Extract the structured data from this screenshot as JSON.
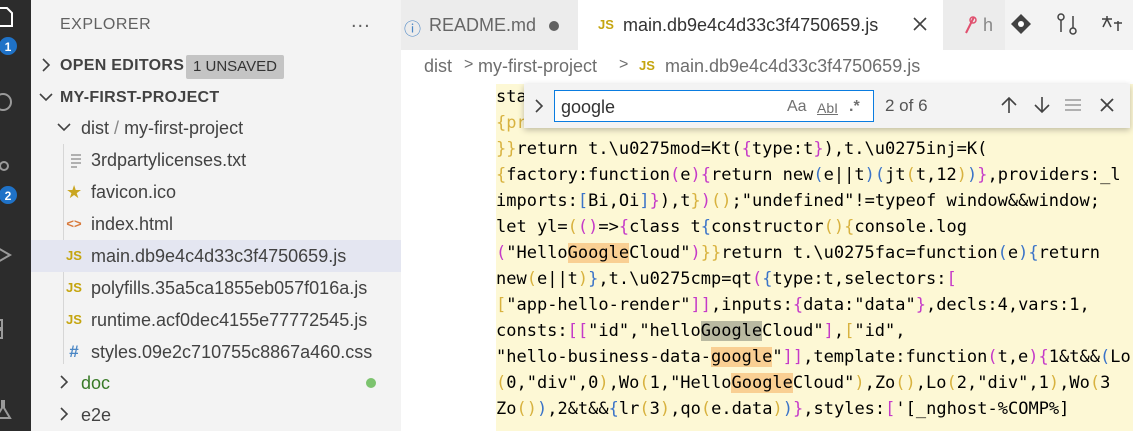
{
  "sidebar": {
    "title": "EXPLORER",
    "more_icon": "...",
    "open_editors": {
      "label": "OPEN EDITORS",
      "badge": "1 UNSAVED"
    },
    "project": {
      "label": "MY-FIRST-PROJECT"
    },
    "folder": {
      "name": "dist",
      "sep": "/",
      "sub": "my-first-project"
    },
    "files": [
      {
        "name": "3rdpartylicenses.txt",
        "icon": "lines-icon"
      },
      {
        "name": "favicon.ico",
        "icon": "star-icon"
      },
      {
        "name": "index.html",
        "icon": "html-icon",
        "glyph": "<>"
      },
      {
        "name": "main.db9e4c4d33c3f4750659.js",
        "icon": "js-icon",
        "glyph": "JS",
        "selected": true
      },
      {
        "name": "polyfills.35a5ca1855eb057f016a.js",
        "icon": "js-icon",
        "glyph": "JS"
      },
      {
        "name": "runtime.acf0dec4155e77772545.js",
        "icon": "js-icon",
        "glyph": "JS"
      },
      {
        "name": "styles.09e2c710755c8867a460.css",
        "icon": "hash-icon",
        "glyph": "#"
      }
    ],
    "doc": "doc",
    "e2e": "e2e"
  },
  "activity": {
    "badges": [
      "1",
      "2"
    ]
  },
  "tabs": [
    {
      "label": "README.md",
      "icon_glyph": "ⓘ"
    },
    {
      "label": "main.db9e4c4d33c3f4750659.js",
      "icon_glyph": "JS"
    },
    {
      "label": "h"
    }
  ],
  "breadcrumb": {
    "p1": "dist",
    "p2": "my-first-project",
    "js": "JS",
    "p3": "main.db9e4c4d33c3f4750659.js"
  },
  "find": {
    "value": "google",
    "opt_case": "Aa",
    "opt_word": "AbI",
    "opt_regex": ".*",
    "count": "2 of 6"
  },
  "code": {
    "l0": "sta",
    "l1": "{pr",
    "l2a": "}}",
    "l2b": "return t.\\u0275mod=Kt(",
    "l2c": "{",
    "l2d": "type:t",
    "l2e": "}",
    "l2f": "),t.\\u0275inj=K(",
    "l3a": "{",
    "l3b": "factory:function",
    "l3c": "(",
    "l3d": "e",
    "l3e": ")",
    "l3f": "{",
    "l3g": "return new",
    "l3h": "(",
    "l3i": "e||t",
    "l3j": ")",
    "l3k": "(",
    "l3l": "jt",
    "l3m": "(",
    "l3n": "t,12",
    "l3o": ")",
    "l3p": ")",
    "l3q": "}",
    "l3r": ",providers:_l",
    "l4a": "imports:",
    "l4b": "[",
    "l4c": "Bi,Oi",
    "l4d": "]",
    "l4e": "}",
    "l4f": "),t",
    "l4g": "}",
    "l4h": ")",
    "l4i": "()",
    "l4j": ";\"undefined\"!=typeof window&&window;",
    "l5a": "let yl=",
    "l5b": "(",
    "l5c": "()",
    "l5d": "=>",
    "l5e": "{",
    "l5f": "class t",
    "l5g": "{",
    "l5h": "constructor",
    "l5i": "()",
    "l5j": "{",
    "l5k": "console.log",
    "l6a": "(",
    "l6b": "\"Hello",
    "l6c": "Google",
    "l6d": "Cloud\"",
    "l6e": ")",
    "l6f": "}}",
    "l6g": "return t.\\u0275fac=function",
    "l6h": "(",
    "l6i": "e",
    "l6j": ")",
    "l6k": "{",
    "l6l": "return",
    "l7a": "new",
    "l7b": "(",
    "l7c": "e||t",
    "l7d": ")",
    "l7e": "}",
    "l7f": ",t.\\u0275cmp=qt",
    "l7g": "(",
    "l7h": "{",
    "l7i": "type:t,selectors:",
    "l7j": "[",
    "l8a": "[",
    "l8b": "\"app-hello-render\"",
    "l8c": "]]",
    "l8d": ",inputs:",
    "l8e": "{",
    "l8f": "data:\"data\"",
    "l8g": "}",
    "l8h": ",decls:4,vars:1,",
    "l9a": "consts:",
    "l9b": "[[",
    "l9c": "\"id\",\"hello",
    "l9d": "Google",
    "l9e": "Cloud\"",
    "l9f": "]",
    "l9g": ",",
    "l9h": "[",
    "l9i": "\"id\",",
    "l10a": "\"hello-business-data-",
    "l10b": "google",
    "l10c": "\"",
    "l10d": "]]",
    "l10e": ",template:function",
    "l10f": "(",
    "l10g": "t,e",
    "l10h": ")",
    "l10i": "{",
    "l10j": "1&t&&",
    "l10k": "(",
    "l10l": "Lo",
    "l11a": "(",
    "l11b": "0,\"div\",0",
    "l11c": ")",
    "l11d": ",Wo",
    "l11e": "(",
    "l11f": "1,\"Hello",
    "l11g": "Google",
    "l11h": "Cloud\"",
    "l11i": ")",
    "l11j": ",Zo",
    "l11k": "()",
    "l11l": ",Lo",
    "l11m": "(",
    "l11n": "2,\"div\",1",
    "l11o": ")",
    "l11p": ",Wo",
    "l11q": "(",
    "l11r": "3",
    "l12a": "Zo",
    "l12b": "()",
    "l12c": ")",
    "l12d": ",2&t&&",
    "l12e": "{",
    "l12f": "lr",
    "l12g": "(",
    "l12h": "3",
    "l12i": ")",
    "l12j": ",qo",
    "l12k": "(",
    "l12l": "e.data",
    "l12m": ")",
    "l12n": ")",
    "l12o": "}",
    "l12p": ",styles:",
    "l12q": "[",
    "l12r": "'[_nghost-%COMP%]"
  },
  "colors": {
    "accent": "#1f72c7",
    "match": "#f9cf93",
    "current_match": "#b9b9a1",
    "code_bg": "#fdf8d5",
    "js_icon": "#c5a50f"
  }
}
